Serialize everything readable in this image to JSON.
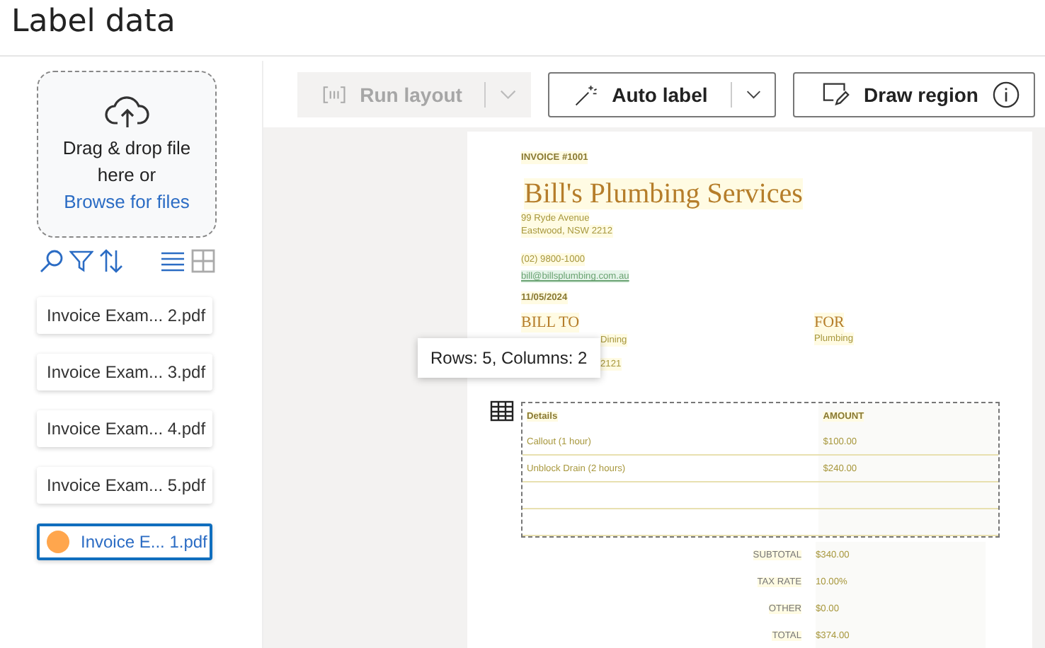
{
  "title": "Label data",
  "upload": {
    "text": "Drag & drop file here or",
    "link": "Browse for files"
  },
  "view_modes": [
    {
      "kind": "list",
      "selected": true
    },
    {
      "kind": "grid",
      "selected": false
    }
  ],
  "files": [
    {
      "name": "Invoice Exam... 2.pdf",
      "selected": false
    },
    {
      "name": "Invoice Exam... 3.pdf",
      "selected": false
    },
    {
      "name": "Invoice Exam... 4.pdf",
      "selected": false
    },
    {
      "name": "Invoice Exam... 5.pdf",
      "selected": false
    },
    {
      "name": "Invoice E... 1.pdf",
      "selected": true,
      "color": "#ffa64d"
    }
  ],
  "toolbar": [
    {
      "kind": "layout",
      "label": "Run layout",
      "disabled": true,
      "split": true
    },
    {
      "kind": "wand",
      "label": "Auto label",
      "disabled": false,
      "split": true
    },
    {
      "kind": "region",
      "label": "Draw region",
      "disabled": false,
      "split": false
    }
  ],
  "document": {
    "invoice_no": "INVOICE #1001",
    "company": "Bill's Plumbing Services",
    "address": [
      "99 Ryde Avenue",
      "Eastwood, NSW 2212"
    ],
    "phone": "(02) 9800-1000",
    "email": "bill@billsplumbing.com.au",
    "date": "11/05/2024",
    "bill_to": "BILL TO",
    "client": [
      "Dining",
      "2121"
    ],
    "for_heading": "FOR",
    "for_value": "Plumbing",
    "table": {
      "columns": [
        "Details",
        "AMOUNT"
      ],
      "rows": [
        [
          "Callout (1 hour)",
          "$100.00"
        ],
        [
          "Unblock Drain (2 hours)",
          "$240.00"
        ],
        [
          "",
          ""
        ],
        [
          "",
          ""
        ]
      ]
    },
    "totals": [
      {
        "label": "SUBTOTAL",
        "value": "$340.00"
      },
      {
        "label": "TAX RATE",
        "value": "10.00%"
      },
      {
        "label": "OTHER",
        "value": "$0.00"
      },
      {
        "label": "TOTAL",
        "value": "$374.00"
      }
    ],
    "tooltip": "Rows: 5, Columns: 2"
  }
}
